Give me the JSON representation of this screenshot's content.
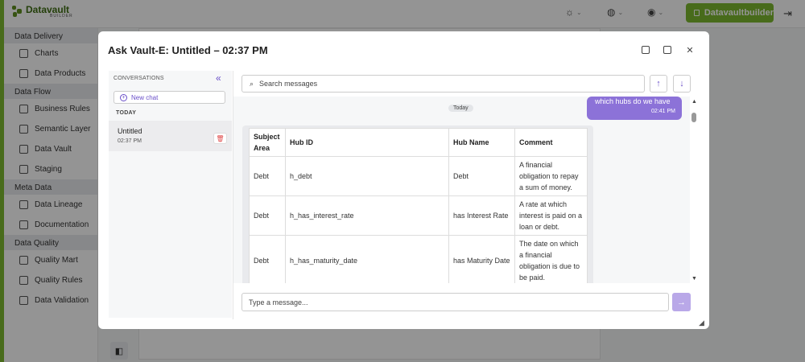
{
  "app": {
    "brand": "Datavault",
    "brand_sub": "BUILDER",
    "user_button": "Datavaultbuilder"
  },
  "sidebar": {
    "sections": [
      {
        "title": "Data Delivery",
        "items": [
          "Charts",
          "Data Products"
        ]
      },
      {
        "title": "Data Flow",
        "items": [
          "Business Rules",
          "Semantic Layer",
          "Data Vault",
          "Staging"
        ]
      },
      {
        "title": "Meta Data",
        "items": [
          "Data Lineage",
          "Documentation"
        ]
      },
      {
        "title": "Data Quality",
        "items": [
          "Quality Mart",
          "Quality Rules",
          "Data Validation"
        ]
      }
    ]
  },
  "modal": {
    "title": "Ask Vault-E: Untitled – 02:37 PM",
    "conversations_label": "CONVERSATIONS",
    "new_chat": "New chat",
    "today_label": "TODAY",
    "conversation": {
      "name": "Untitled",
      "time": "02:37 PM"
    },
    "search_placeholder": "Search messages",
    "date_divider": "Today",
    "user_message": {
      "text": "which hubs do we have",
      "time": "02:41 PM"
    },
    "input_placeholder": "Type a message..."
  },
  "table": {
    "headers": [
      "Subject Area",
      "Hub ID",
      "Hub Name",
      "Comment"
    ],
    "rows": [
      [
        "Debt",
        "h_debt",
        "Debt",
        "A financial obligation to repay a sum of money."
      ],
      [
        "Debt",
        "h_has_interest_rate",
        "has Interest Rate",
        "A rate at which interest is paid on a loan or debt."
      ],
      [
        "Debt",
        "h_has_maturity_date",
        "has Maturity Date",
        "The date on which a financial obligation is due to be paid."
      ]
    ]
  },
  "colors": {
    "accent": "#7cb82f",
    "purple": "#8c72d8"
  }
}
